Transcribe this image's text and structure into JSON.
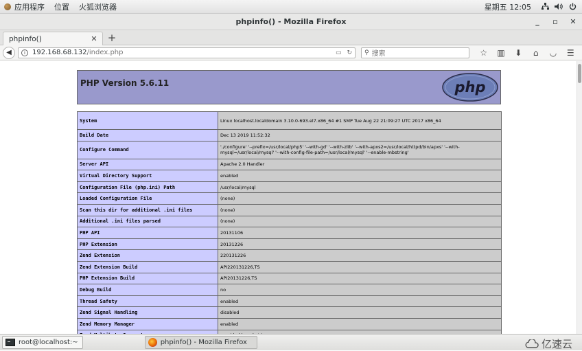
{
  "top_panel": {
    "apps_menu": "应用程序",
    "places_menu": "位置",
    "firefox_menu": "火狐浏览器",
    "clock": "星期五 12:05"
  },
  "window": {
    "title": "phpinfo() - Mozilla Firefox"
  },
  "tabs": [
    {
      "label": "phpinfo()"
    }
  ],
  "navbar": {
    "url_host": "192.168.68.132",
    "url_path": "/index.php",
    "search_placeholder": "搜索"
  },
  "php": {
    "version_title": "PHP Version 5.6.11",
    "logo_text": "php",
    "rows": [
      {
        "key": "System",
        "value": "Linux localhost.localdomain 3.10.0-693.el7.x86_64 #1 SMP Tue Aug 22 21:09:27 UTC 2017 x86_64"
      },
      {
        "key": "Build Date",
        "value": "Dec 13 2019 11:52:32"
      },
      {
        "key": "Configure Command",
        "value": "'./configure' '--prefix=/usr/local/php5' '--with-gd' '--with-zlib' '--with-apxs2=/usr/local/httpd/bin/apxs' '--with-mysql=/usr/local/mysql' '--with-config-file-path=/usr/local/mysql' '--enable-mbstring'"
      },
      {
        "key": "Server API",
        "value": "Apache 2.0 Handler"
      },
      {
        "key": "Virtual Directory Support",
        "value": "enabled"
      },
      {
        "key": "Configuration File (php.ini) Path",
        "value": "/usr/local/mysql"
      },
      {
        "key": "Loaded Configuration File",
        "value": "(none)"
      },
      {
        "key": "Scan this dir for additional .ini files",
        "value": "(none)"
      },
      {
        "key": "Additional .ini files parsed",
        "value": "(none)"
      },
      {
        "key": "PHP API",
        "value": "20131106"
      },
      {
        "key": "PHP Extension",
        "value": "20131226"
      },
      {
        "key": "Zend Extension",
        "value": "220131226"
      },
      {
        "key": "Zend Extension Build",
        "value": "API220131226,TS"
      },
      {
        "key": "PHP Extension Build",
        "value": "API20131226,TS"
      },
      {
        "key": "Debug Build",
        "value": "no"
      },
      {
        "key": "Thread Safety",
        "value": "enabled"
      },
      {
        "key": "Zend Signal Handling",
        "value": "disabled"
      },
      {
        "key": "Zend Memory Manager",
        "value": "enabled"
      },
      {
        "key": "Zend Multibyte Support",
        "value": "provided by mbstring"
      }
    ]
  },
  "taskbar": {
    "items": [
      {
        "label": "root@localhost:~"
      },
      {
        "label": "phpinfo() - Mozilla Firefox"
      }
    ],
    "watermark": "亿速云"
  },
  "icons": {
    "back": "arrow-left-icon",
    "info": "info-icon",
    "reader": "reader-view-icon",
    "reload": "reload-icon",
    "search": "search-icon",
    "bookmark": "star-icon",
    "library": "library-icon",
    "download": "download-icon",
    "home": "home-icon",
    "pocket": "pocket-icon",
    "menu": "hamburger-menu-icon",
    "network": "network-icon",
    "volume": "volume-icon",
    "power": "power-icon"
  },
  "colors": {
    "php_header": "#9999cc",
    "key_cell": "#ccccff",
    "value_cell": "#cccccc"
  }
}
